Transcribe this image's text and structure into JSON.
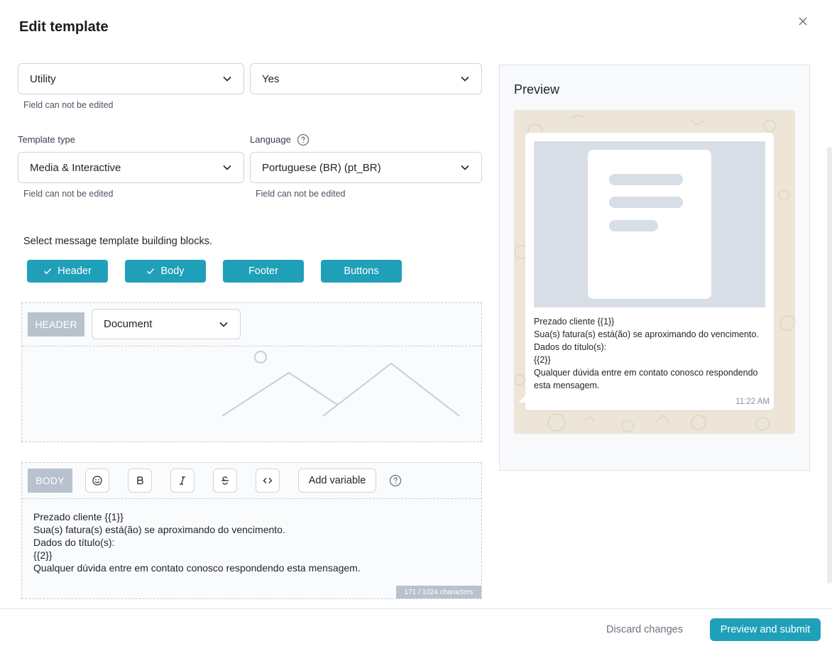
{
  "modal": {
    "title": "Edit template"
  },
  "category": {
    "value": "Utility",
    "hint": "Field can not be edited"
  },
  "allow_change": {
    "value": "Yes"
  },
  "template_type": {
    "label": "Template type",
    "value": "Media & Interactive",
    "hint": "Field can not be edited"
  },
  "language": {
    "label": "Language",
    "value": "Portuguese (BR) (pt_BR)",
    "hint": "Field can not be edited"
  },
  "blocks": {
    "title": "Select message template building blocks.",
    "items": [
      {
        "label": "Header",
        "checked": true
      },
      {
        "label": "Body",
        "checked": true
      },
      {
        "label": "Footer",
        "checked": false
      },
      {
        "label": "Buttons",
        "checked": false
      }
    ]
  },
  "header_section": {
    "tag": "HEADER",
    "media_type": "Document"
  },
  "body_section": {
    "tag": "BODY",
    "add_variable": "Add variable",
    "lines": [
      "Prezado cliente {{1}}",
      "Sua(s) fatura(s) está(ão) se aproximando do vencimento.",
      "Dados do título(s):",
      "{{2}}",
      "Qualquer dúvida entre em contato conosco respondendo esta mensagem."
    ],
    "char_count": "171 / 1024 characters"
  },
  "preview": {
    "title": "Preview",
    "lines": [
      "Prezado cliente {{1}}",
      "Sua(s) fatura(s) está(ão) se aproximando do vencimento.",
      "Dados do título(s):",
      "{{2}}",
      "Qualquer dúvida entre em contato conosco respondendo esta mensagem."
    ],
    "time": "11:22 AM"
  },
  "footer": {
    "discard": "Discard changes",
    "submit": "Preview and submit"
  },
  "colors": {
    "accent": "#1fa0b8",
    "tag": "#b8c2ce",
    "chat_bg": "#ece5d8"
  }
}
